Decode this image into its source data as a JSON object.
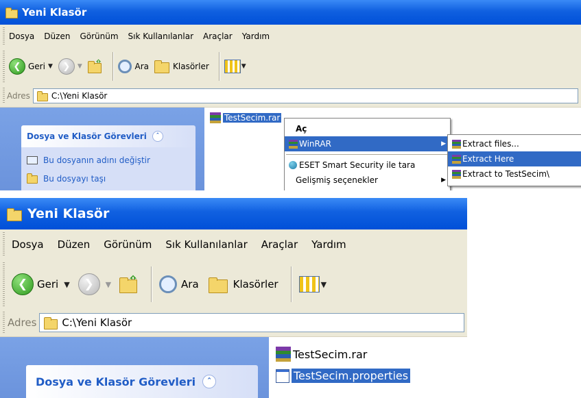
{
  "top": {
    "title": "Yeni Klasör",
    "menu": [
      "Dosya",
      "Düzen",
      "Görünüm",
      "Sık Kullanılanlar",
      "Araçlar",
      "Yardım"
    ],
    "toolbar": {
      "back": "Geri",
      "search": "Ara",
      "folders": "Klasörler"
    },
    "address": {
      "label": "Adres",
      "path": "C:\\Yeni Klasör"
    },
    "taskpane": {
      "title": "Dosya ve Klasör Görevleri",
      "links": [
        "Bu dosyanın adını değiştir",
        "Bu dosyayı taşı"
      ]
    },
    "files": [
      "TestSecim.rar"
    ],
    "context_menu": {
      "items": [
        "Aç",
        "WinRAR",
        "ESET Smart Security ile tara",
        "Gelişmiş seçenekler"
      ],
      "submenu": [
        "Extract files...",
        "Extract Here",
        "Extract to TestSecim\\"
      ]
    }
  },
  "bottom": {
    "title": "Yeni Klasör",
    "menu": [
      "Dosya",
      "Düzen",
      "Görünüm",
      "Sık Kullanılanlar",
      "Araçlar",
      "Yardım"
    ],
    "toolbar": {
      "back": "Geri",
      "search": "Ara",
      "folders": "Klasörler"
    },
    "address": {
      "label": "Adres",
      "path": "C:\\Yeni Klasör"
    },
    "taskpane": {
      "title": "Dosya ve Klasör Görevleri"
    },
    "files": [
      "TestSecim.rar",
      "TestSecim.properties"
    ]
  },
  "colors": {
    "titlebar": "#0a5ce0",
    "selection": "#316ac5",
    "taskpane": "#7aa2e6",
    "task_text": "#215dc6"
  }
}
